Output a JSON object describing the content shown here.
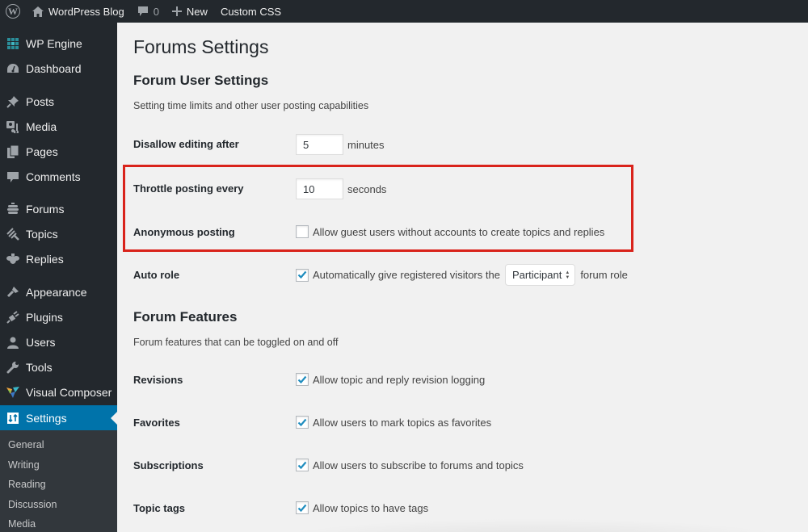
{
  "admin_bar": {
    "wp_logo": "wordpress-logo",
    "site_name": "WordPress Blog",
    "comments_count": "0",
    "new_label": "New",
    "custom_css_label": "Custom CSS"
  },
  "sidebar": {
    "items": [
      {
        "label": "WP Engine",
        "icon": "wp-engine-icon"
      },
      {
        "label": "Dashboard",
        "icon": "dashboard-icon"
      },
      {
        "label": "Posts",
        "icon": "pin-icon"
      },
      {
        "label": "Media",
        "icon": "media-icon"
      },
      {
        "label": "Pages",
        "icon": "pages-icon"
      },
      {
        "label": "Comments",
        "icon": "comment-icon"
      },
      {
        "label": "Forums",
        "icon": "forums-icon"
      },
      {
        "label": "Topics",
        "icon": "topics-icon"
      },
      {
        "label": "Replies",
        "icon": "replies-icon"
      },
      {
        "label": "Appearance",
        "icon": "paintbrush-icon"
      },
      {
        "label": "Plugins",
        "icon": "plugin-icon"
      },
      {
        "label": "Users",
        "icon": "user-icon"
      },
      {
        "label": "Tools",
        "icon": "wrench-icon"
      },
      {
        "label": "Visual Composer",
        "icon": "visual-composer-icon"
      },
      {
        "label": "Settings",
        "icon": "settings-icon",
        "active": true
      }
    ],
    "submenu": [
      "General",
      "Writing",
      "Reading",
      "Discussion",
      "Media"
    ]
  },
  "main": {
    "page_title": "Forums Settings",
    "user_settings": {
      "title": "Forum User Settings",
      "description": "Setting time limits and other user posting capabilities",
      "disallow_editing": {
        "label": "Disallow editing after",
        "value": "5",
        "unit": "minutes"
      },
      "throttle_posting": {
        "label": "Throttle posting every",
        "value": "10",
        "unit": "seconds"
      },
      "anonymous_posting": {
        "label": "Anonymous posting",
        "checked": false,
        "text": "Allow guest users without accounts to create topics and replies"
      },
      "auto_role": {
        "label": "Auto role",
        "checked": true,
        "text_before": "Automatically give registered visitors the",
        "selected_role": "Participant",
        "text_after": "forum role"
      }
    },
    "features": {
      "title": "Forum Features",
      "description": "Forum features that can be toggled on and off",
      "revisions": {
        "label": "Revisions",
        "checked": true,
        "text": "Allow topic and reply revision logging"
      },
      "favorites": {
        "label": "Favorites",
        "checked": true,
        "text": "Allow users to mark topics as favorites"
      },
      "subscriptions": {
        "label": "Subscriptions",
        "checked": true,
        "text": "Allow users to subscribe to forums and topics"
      },
      "topic_tags": {
        "label": "Topic tags",
        "checked": true,
        "text": "Allow topics to have tags"
      }
    }
  },
  "colors": {
    "admin_bar_bg": "#23282d",
    "sidebar_bg": "#23282d",
    "submenu_bg": "#32373c",
    "active_menu": "#0073aa",
    "checkmark": "#1e8cbe",
    "highlight_border": "#d9231b",
    "content_bg": "#f1f1f1"
  }
}
